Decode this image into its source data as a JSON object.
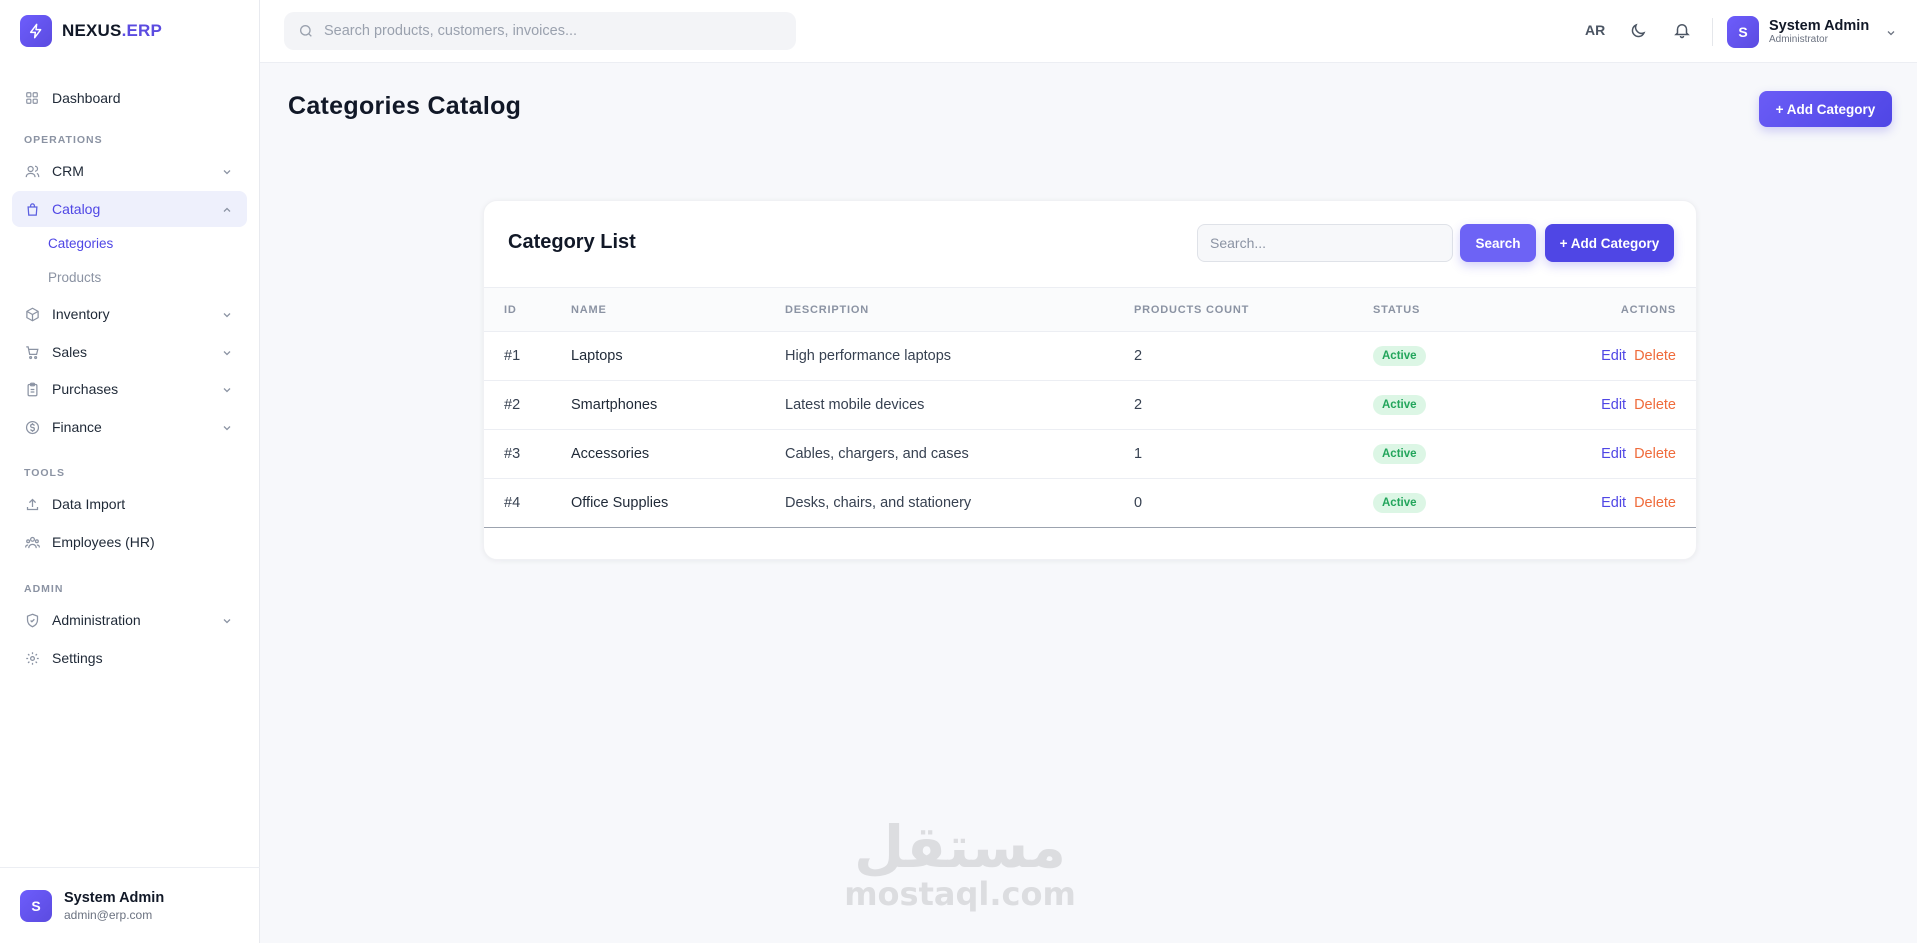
{
  "brand": {
    "name": "NEXUS",
    "suffix": ".ERP"
  },
  "sidebar": {
    "dashboard": "Dashboard",
    "section_operations": "OPERATIONS",
    "crm": "CRM",
    "catalog": "Catalog",
    "catalog_sub": [
      "Categories",
      "Products"
    ],
    "inventory": "Inventory",
    "sales": "Sales",
    "purchases": "Purchases",
    "finance": "Finance",
    "section_tools": "TOOLS",
    "data_import": "Data Import",
    "employees": "Employees (HR)",
    "section_admin": "ADMIN",
    "administration": "Administration",
    "settings": "Settings",
    "user": {
      "initial": "S",
      "name": "System Admin",
      "email": "admin@erp.com"
    }
  },
  "topbar": {
    "search_placeholder": "Search products, customers, invoices...",
    "lang": "AR",
    "user": {
      "initial": "S",
      "name": "System Admin",
      "role": "Administrator"
    }
  },
  "page": {
    "title": "Categories Catalog",
    "add_button": "+ Add Category"
  },
  "card": {
    "title": "Category List",
    "search_placeholder": "Search...",
    "search_button": "Search",
    "add_button": "+ Add Category",
    "columns": [
      "ID",
      "NAME",
      "DESCRIPTION",
      "PRODUCTS COUNT",
      "STATUS",
      "ACTIONS"
    ],
    "rows": [
      {
        "id": "#1",
        "name": "Laptops",
        "description": "High performance laptops",
        "count": "2",
        "status": "Active"
      },
      {
        "id": "#2",
        "name": "Smartphones",
        "description": "Latest mobile devices",
        "count": "2",
        "status": "Active"
      },
      {
        "id": "#3",
        "name": "Accessories",
        "description": "Cables, chargers, and cases",
        "count": "1",
        "status": "Active"
      },
      {
        "id": "#4",
        "name": "Office Supplies",
        "description": "Desks, chairs, and stationery",
        "count": "0",
        "status": "Active"
      }
    ],
    "edit_label": "Edit",
    "delete_label": "Delete"
  },
  "watermark": {
    "arabic": "مستقل",
    "latin": "mostaql.com"
  },
  "colors": {
    "accent": "#4f46e5",
    "status_active": "#22a55b",
    "delete": "#ef6b3b"
  }
}
